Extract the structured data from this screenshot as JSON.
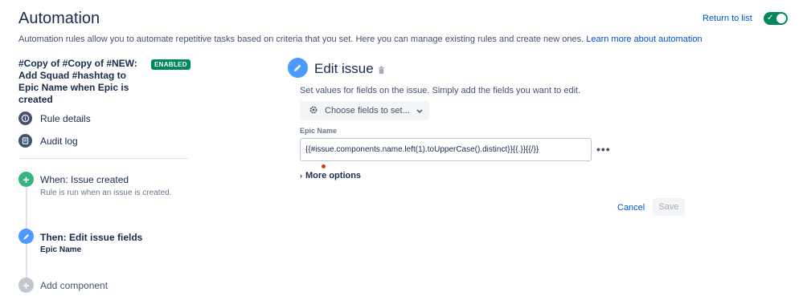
{
  "header": {
    "title": "Automation",
    "return_label": "Return to list",
    "toggle_on": true
  },
  "description": {
    "text": "Automation rules allow you to automate repetitive tasks based on criteria that you set. Here you can manage existing rules and create new ones.",
    "link": "Learn more about automation"
  },
  "rule": {
    "name": "#Copy of #Copy of #NEW: Add Squad #hashtag to Epic Name when Epic is created",
    "status": "ENABLED"
  },
  "nav": {
    "rule_details": "Rule details",
    "audit_log": "Audit log"
  },
  "steps": [
    {
      "title": "When: Issue created",
      "subtitle": "Rule is run when an issue is created."
    },
    {
      "title": "Then: Edit issue fields",
      "subtitle": "Epic Name"
    },
    {
      "title": "Add component"
    }
  ],
  "editor": {
    "title": "Edit issue",
    "description": "Set values for fields on the issue. Simply add the fields you want to edit.",
    "choose_label": "Choose fields to set...",
    "field_label": "Epic Name",
    "field_value": "{{#issue.components.name.left(1).toUpperCase().distinct}}{{.}}{{/}}",
    "more_options": "More options",
    "cancel": "Cancel",
    "save": "Save"
  },
  "colors": {
    "accent": "#0052cc",
    "success": "#00875a",
    "trigger": "#36b37e",
    "action": "#4c9aff"
  }
}
